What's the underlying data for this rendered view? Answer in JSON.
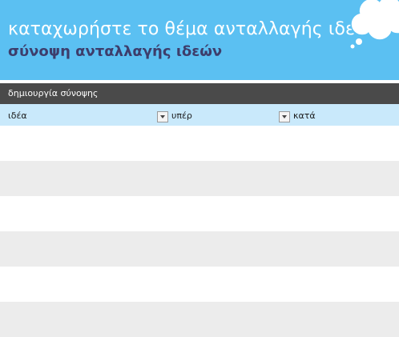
{
  "banner": {
    "title": "καταχωρήστε το θέμα ανταλλαγής ιδεών",
    "subtitle": "σύνοψη ανταλλαγής ιδεών"
  },
  "summary_bar": {
    "label": "δημιουργία σύνοψης"
  },
  "table": {
    "columns": [
      "ιδέα",
      "υπέρ",
      "κατά"
    ],
    "row_count": 6
  },
  "colors": {
    "banner_bg": "#5bc0f2",
    "subtitle": "#3d3d6b",
    "summary_bar_bg": "#4a4a4a",
    "header_row_bg": "#c9e9fb",
    "stripe": "#ececec"
  }
}
